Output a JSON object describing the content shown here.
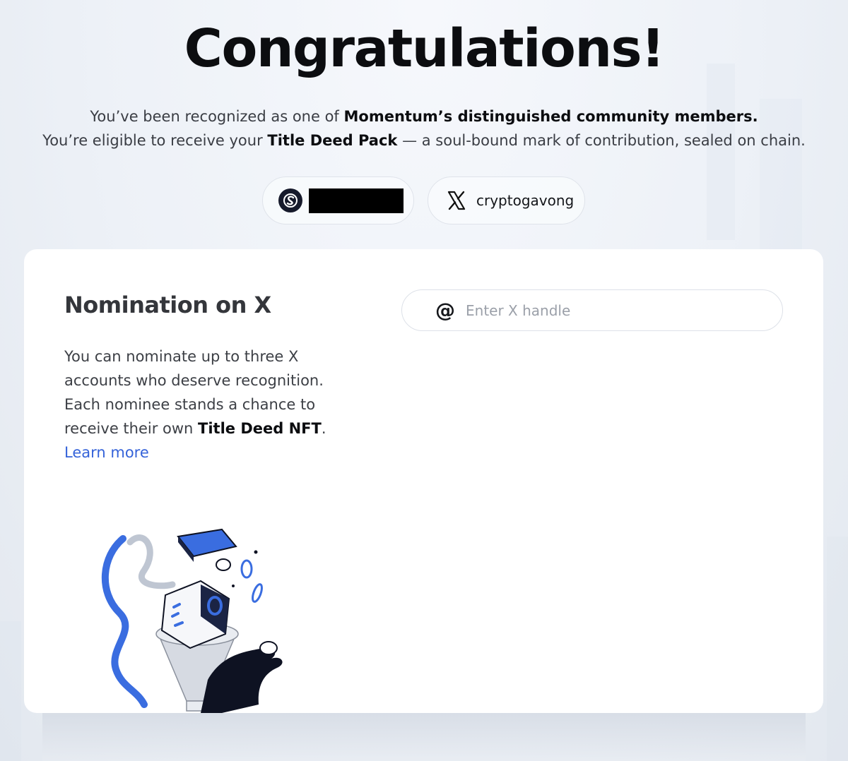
{
  "header": {
    "title": "Congratulations!",
    "line1_prefix": "You’ve been recognized as one of ",
    "line1_bold": "Momentum’s distinguished community members.",
    "line2_prefix": "You’re eligible to receive your ",
    "line2_bold": "Title Deed Pack",
    "line2_suffix": " — a soul-bound mark of contribution, sealed on chain."
  },
  "accounts": {
    "wallet_icon": "wallet-logo-icon",
    "x_icon": "x-logo-icon",
    "x_handle": "cryptogavong"
  },
  "nomination": {
    "heading": "Nomination on X",
    "desc_1": "You can nominate up to three X accounts who deserve recognition.",
    "desc_2_prefix": "Each nominee stands a chance to receive their own ",
    "desc_2_bold": "Title Deed NFT",
    "desc_2_suffix": ".",
    "learn_more": "Learn more",
    "input_icon": "at-sign-icon",
    "input_placeholder": "Enter X handle",
    "input_value": ""
  },
  "colors": {
    "accent": "#3563d9",
    "title": "#0c0d10",
    "card_bg": "#ffffff"
  }
}
